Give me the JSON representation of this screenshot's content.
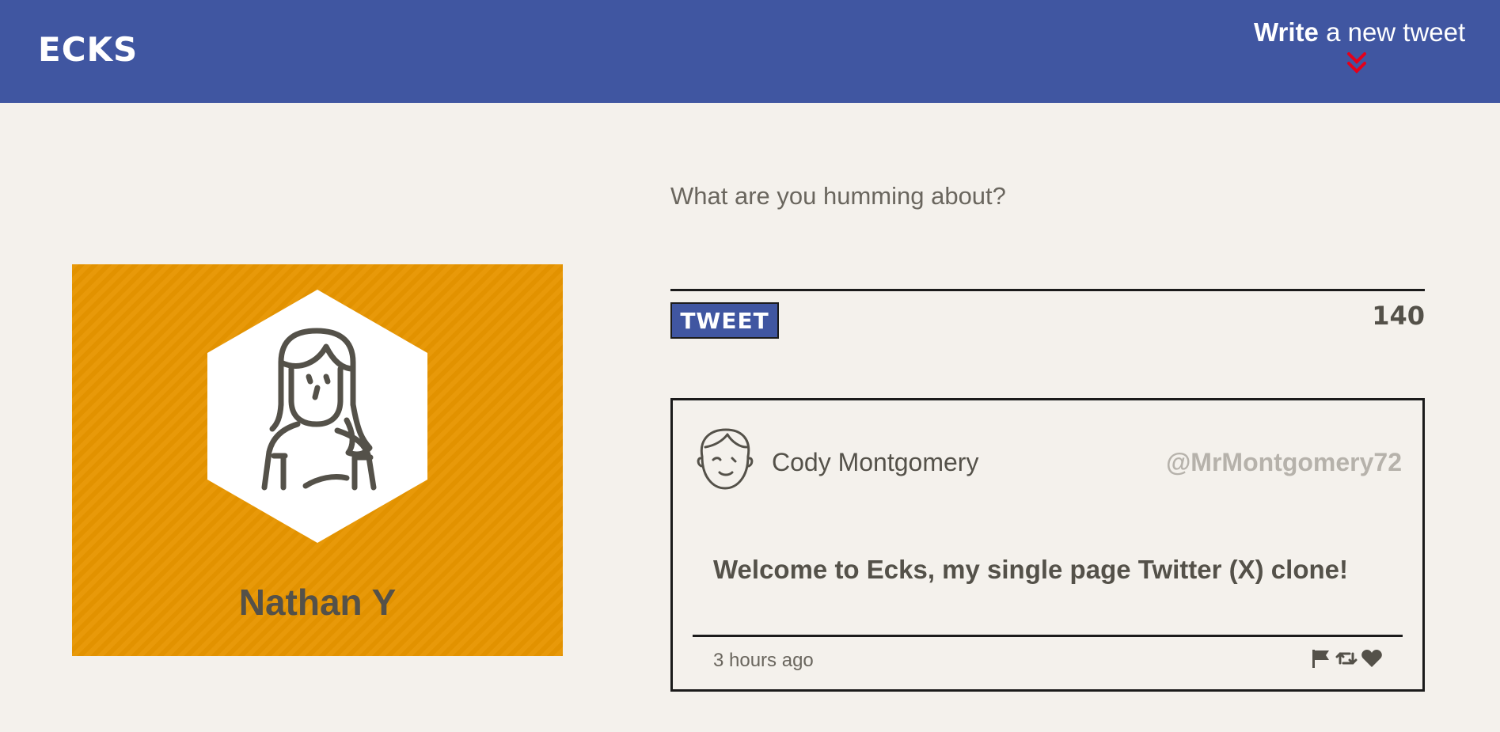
{
  "header": {
    "brand": "ECKS",
    "write_toggle": {
      "bold": "Write",
      "rest": "a new tweet"
    }
  },
  "profile": {
    "name": "Nathan Y",
    "avatar_icon": "woman-avatar-icon",
    "background_color": "#e79500"
  },
  "composer": {
    "placeholder": "What are you humming about?",
    "value": "",
    "button_label": "TWEET",
    "char_count": "140"
  },
  "tweets": [
    {
      "author_name": "Cody Montgomery",
      "handle": "@MrMontgomery72",
      "content": "Welcome to Ecks, my single page Twitter (X) clone!",
      "time": "3 hours ago",
      "avatar_icon": "man-avatar-icon",
      "actions": [
        "flag-icon",
        "retweet-icon",
        "heart-icon"
      ]
    }
  ],
  "colors": {
    "header": "#4056a1",
    "accent_chevron": "#e3001b",
    "page_background": "#f4f1ec",
    "text": "#545149",
    "handle": "#b6b2ab"
  }
}
